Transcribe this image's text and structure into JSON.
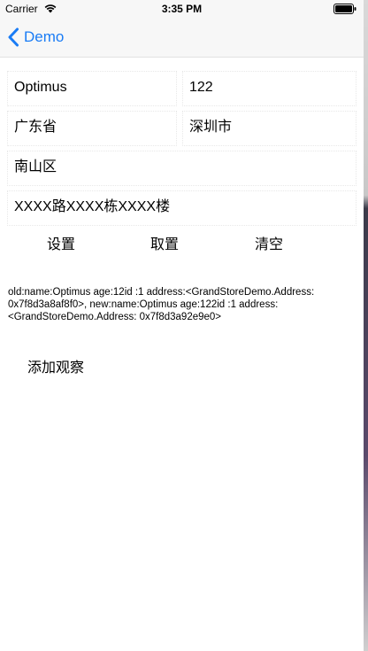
{
  "status_bar": {
    "carrier": "Carrier",
    "time": "3:35 PM",
    "wifi_icon": "wifi-icon",
    "battery_icon": "battery-icon"
  },
  "nav_bar": {
    "back_label": "Demo",
    "back_icon": "chevron-left-icon",
    "accent_color": "#1a7cf5"
  },
  "form": {
    "name": "Optimus",
    "age": "122",
    "province": "广东省",
    "city": "深圳市",
    "district": "南山区",
    "street": "XXXX路XXXX栋XXXX楼"
  },
  "actions": {
    "set_label": "设置",
    "get_label": "取置",
    "clear_label": "清空"
  },
  "log": {
    "text": "old:name:Optimus age:12id :1 address:<GrandStoreDemo.Address: 0x7f8d3a8af8f0>, new:name:Optimus age:122id :1 address:<GrandStoreDemo.Address: 0x7f8d3a92e9e0>"
  },
  "observe": {
    "label": "添加观察"
  }
}
